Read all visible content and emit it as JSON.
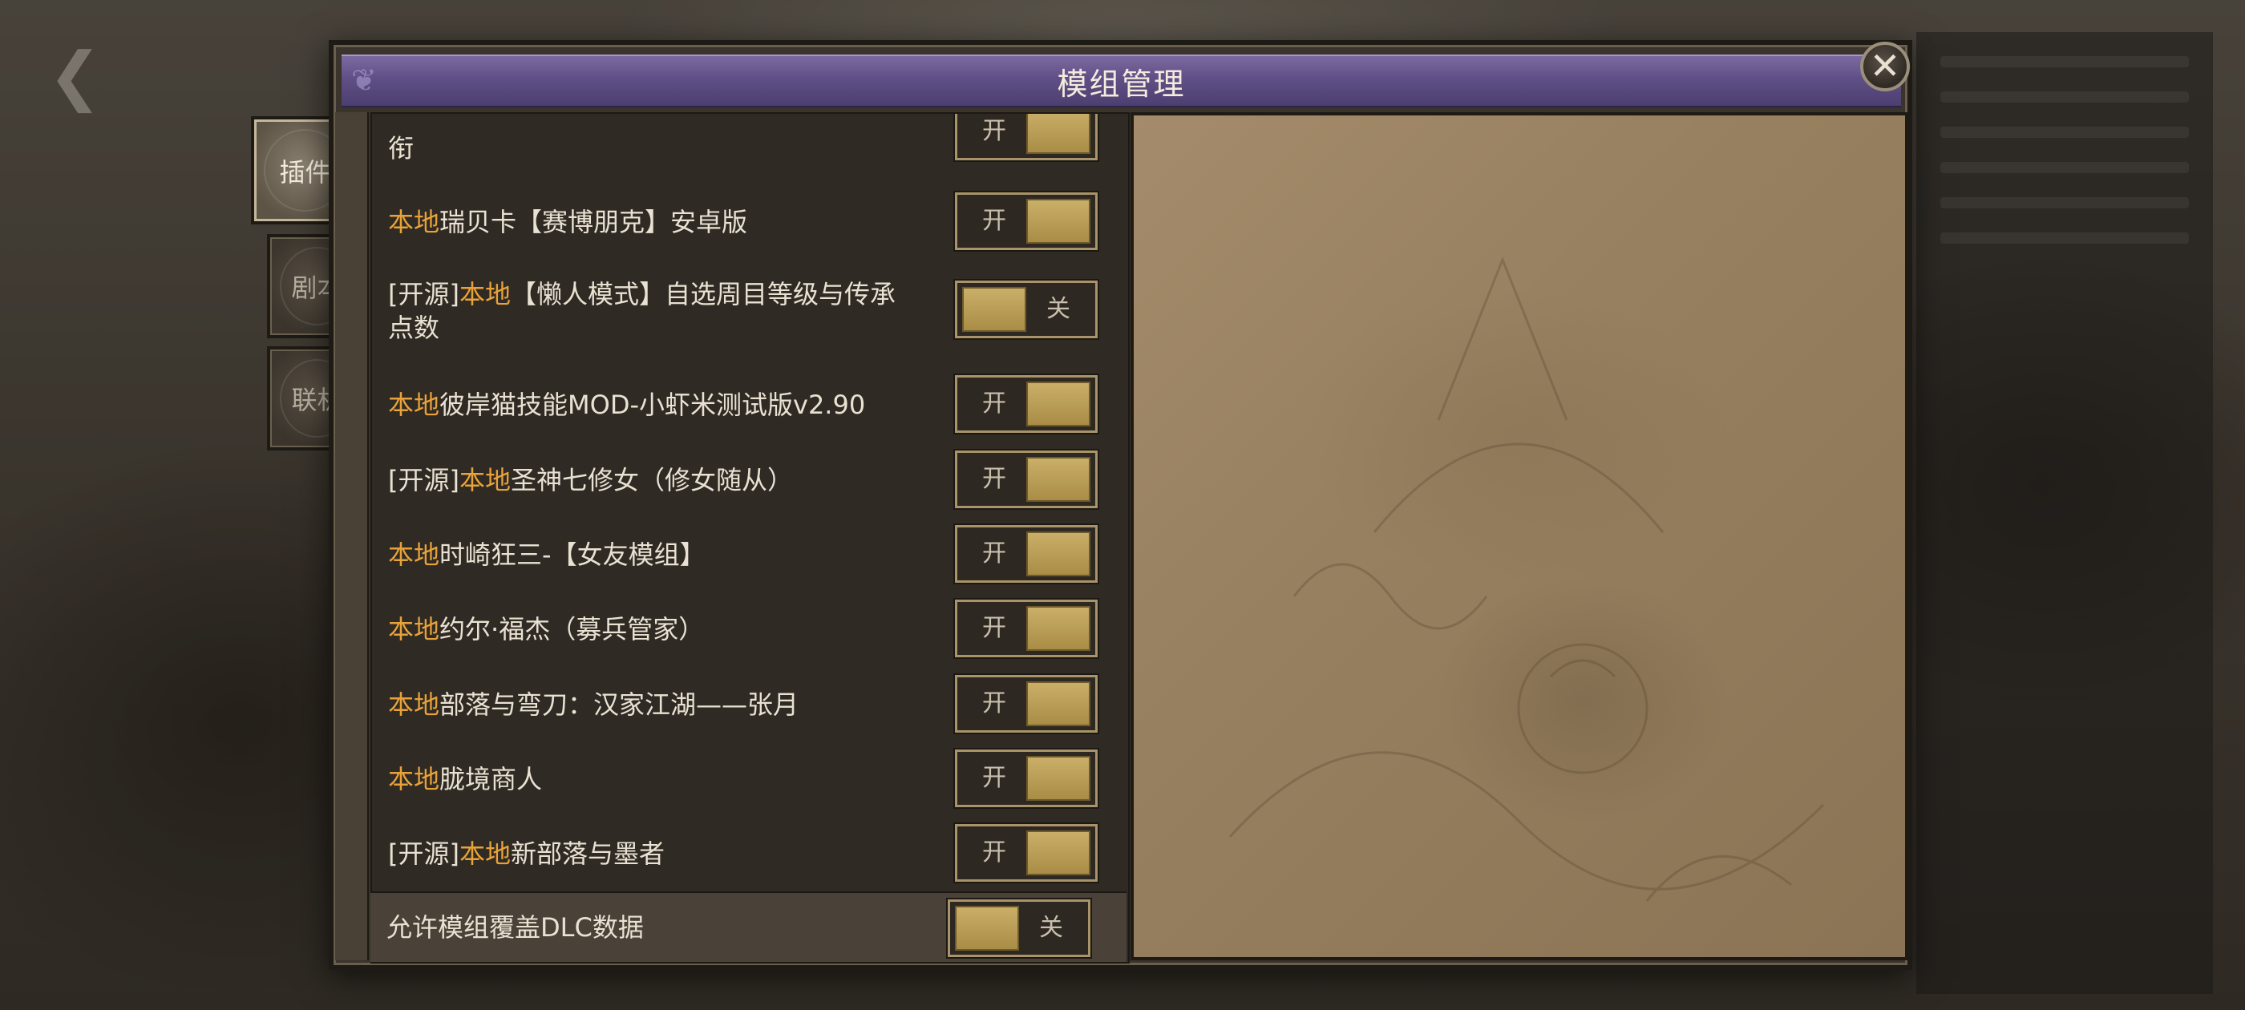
{
  "dialog": {
    "title": "模组管理"
  },
  "tabs": [
    {
      "label": "插件",
      "active": true
    },
    {
      "label": "剧本",
      "active": false
    },
    {
      "label": "联机",
      "active": false
    }
  ],
  "tag_labels": {
    "local": "本地",
    "open": "[开源]"
  },
  "toggle_labels": {
    "on": "开",
    "off": "关"
  },
  "mods": [
    {
      "prefix": "",
      "local": "",
      "name": "衔",
      "state": "开",
      "on": true
    },
    {
      "prefix": "",
      "local": "本地",
      "name": "瑞贝卡【赛博朋克】安卓版",
      "state": "开",
      "on": true
    },
    {
      "prefix": "[开源]",
      "local": "本地",
      "name": "【懒人模式】自选周目等级与传承点数",
      "state": "关",
      "on": false
    },
    {
      "prefix": "",
      "local": "本地",
      "name": "彼岸猫技能MOD-小虾米测试版v2.90",
      "state": "开",
      "on": true
    },
    {
      "prefix": "[开源]",
      "local": "本地",
      "name": "圣神七修女（修女随从）",
      "state": "开",
      "on": true
    },
    {
      "prefix": "",
      "local": "本地",
      "name": "时崎狂三-【女友模组】",
      "state": "开",
      "on": true
    },
    {
      "prefix": "",
      "local": "本地",
      "name": "约尔·福杰（募兵管家）",
      "state": "开",
      "on": true
    },
    {
      "prefix": "",
      "local": "本地",
      "name": "部落与弯刀：汉家江湖——张月",
      "state": "开",
      "on": true
    },
    {
      "prefix": "",
      "local": "本地",
      "name": "胧境商人",
      "state": "开",
      "on": true
    },
    {
      "prefix": "[开源]",
      "local": "本地",
      "name": "新部落与墨者",
      "state": "开",
      "on": true
    }
  ],
  "footer": {
    "label": "允许模组覆盖DLC数据",
    "state": "关",
    "on": false
  },
  "colors": {
    "accent_local": "#e8a23a",
    "title_bar": "#5f4f86",
    "toggle_knob": "#cbb06a"
  },
  "icons": {
    "close": "close-icon",
    "back": "back-arrow-icon"
  }
}
